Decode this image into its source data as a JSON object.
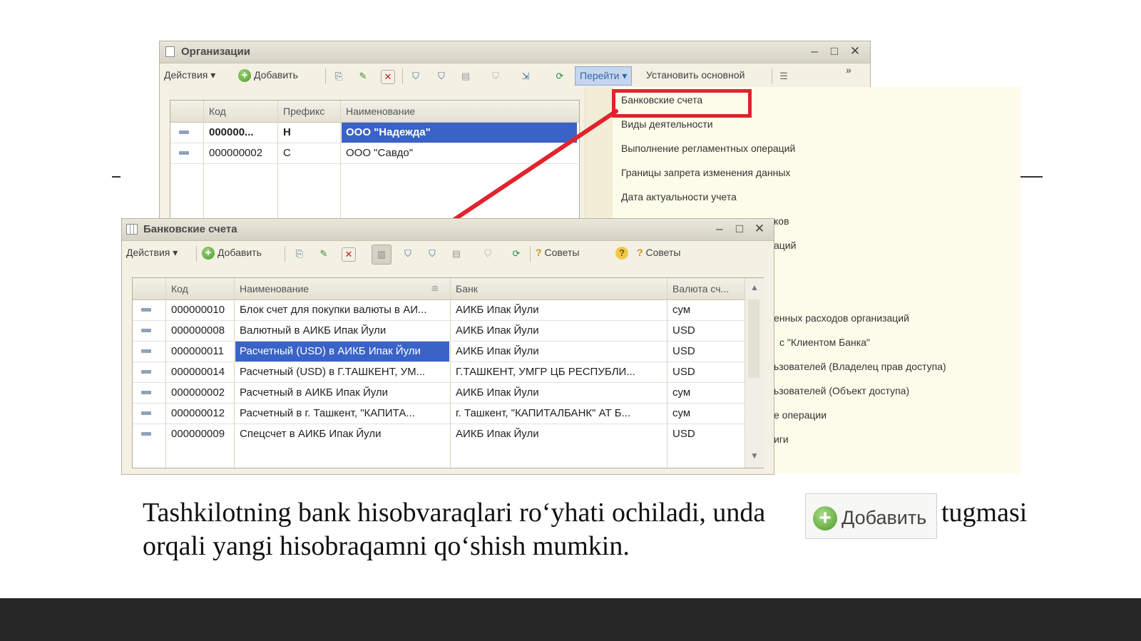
{
  "org_window": {
    "title": "Организации",
    "toolbar": {
      "actions": "Действия",
      "add": "Добавить",
      "goto": "Перейти",
      "set_main": "Установить основной",
      "more": "»"
    },
    "columns": [
      "Код",
      "Префикс",
      "Наименование"
    ],
    "rows": [
      {
        "code": "000000...",
        "prefix": "Н",
        "name": "ООО \"Надежда\"",
        "selected": true
      },
      {
        "code": "000000002",
        "prefix": "С",
        "name": "ООО \"Савдо\"",
        "selected": false
      }
    ]
  },
  "goto_menu": {
    "items": [
      "Банковские счета",
      "Виды деятельности",
      "Выполнение регламентных операций",
      "Границы запрета изменения данных",
      "Дата актуальности учета"
    ],
    "partial_items": [
      "ков",
      "аций",
      "енных расходов организаций",
      "с \"Клиентом Банка\"",
      "ьзователей (Владелец прав доступа)",
      "ьзователей (Объект доступа)",
      "е операции",
      "иги"
    ],
    "highlight_color": "#e0242e"
  },
  "bank_window": {
    "title": "Банковские счета",
    "toolbar": {
      "actions": "Действия",
      "add": "Добавить",
      "tips1": "Советы",
      "tips2": "Советы",
      "help": "?"
    },
    "columns": [
      "Код",
      "Наименование",
      "Банк",
      "Валюта сч..."
    ],
    "rows": [
      {
        "code": "000000010",
        "name": "Блок счет для покупки валюты в АИ...",
        "bank": "АИКБ Ипак Йули",
        "currency": "сум"
      },
      {
        "code": "000000008",
        "name": "Валютный в АИКБ Ипак Йули",
        "bank": "АИКБ Ипак Йули",
        "currency": "USD"
      },
      {
        "code": "000000011",
        "name": "Расчетный (USD) в АИКБ Ипак Йули",
        "bank": "АИКБ Ипак Йули",
        "currency": "USD"
      },
      {
        "code": "000000014",
        "name": "Расчетный (USD) в Г.ТАШКЕНТ, УМ...",
        "bank": "Г.ТАШКЕНТ, УМГР ЦБ РЕСПУБЛИ...",
        "currency": "USD"
      },
      {
        "code": "000000002",
        "name": "Расчетный в АИКБ Ипак Йули",
        "bank": "АИКБ Ипак Йули",
        "currency": "сум"
      },
      {
        "code": "000000012",
        "name": "Расчетный в г. Ташкент, \"КАПИТА...",
        "bank": "г. Ташкент, \"КАПИТАЛБАНК\" АТ Б...",
        "currency": "сум"
      },
      {
        "code": "000000009",
        "name": "Спецсчет в АИКБ Ипак Йули",
        "bank": "АИКБ Ипак Йули",
        "currency": "USD"
      }
    ],
    "selected_row": 2
  },
  "caption": {
    "line1_before": "Tashkilotning bank hisobvaraqlari ro‘yhati ochiladi, unda",
    "button_label": "Добавить",
    "line1_after": "tugmasi",
    "line2": "orqali yangi hisobraqamni qo‘shish mumkin."
  },
  "colors": {
    "selection": "#3a63c7",
    "footer": "#262626",
    "arrow": "#e0242e"
  }
}
